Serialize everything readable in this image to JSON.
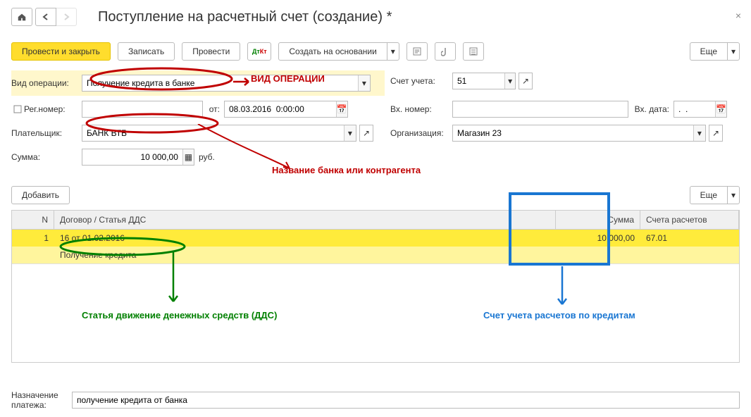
{
  "title": "Поступление на расчетный счет (создание) *",
  "toolbar": {
    "post_close": "Провести и закрыть",
    "write": "Записать",
    "post": "Провести",
    "create_based": "Создать на основании",
    "more": "Еще"
  },
  "labels": {
    "op_type": "Вид операции:",
    "reg_no": "Рег.номер:",
    "from": "от:",
    "payer": "Плательщик:",
    "sum": "Сумма:",
    "currency": "руб.",
    "account": "Счет учета:",
    "in_no": "Вх. номер:",
    "in_date": "Вх. дата:",
    "org": "Организация:",
    "add": "Добавить",
    "purpose1": "Назначение",
    "purpose2": "платежа:"
  },
  "values": {
    "op_type": "Получение кредита в банке",
    "date": "08.03.2016  0:00:00",
    "payer": "БАНК ВТБ",
    "sum": "10 000,00",
    "account": "51",
    "org": "Магазин 23",
    "in_date": ".  .",
    "purpose": "получение кредита от банка"
  },
  "table": {
    "headers": {
      "n": "N",
      "dog": "Договор / Статья ДДС",
      "sum": "Сумма",
      "acc": "Счета расчетов"
    },
    "row": {
      "n": "1",
      "dog": "16 от 01.02.2016",
      "dds": "Получение кредита",
      "sum": "10 000,00",
      "acc": "67.01"
    }
  },
  "annotations": {
    "op": "ВИД ОПЕРАЦИИ",
    "bank": "Название банка или контрагента",
    "dds": "Статья движение денежных средств (ДДС)",
    "acc": "Счет учета расчетов по кредитам"
  }
}
